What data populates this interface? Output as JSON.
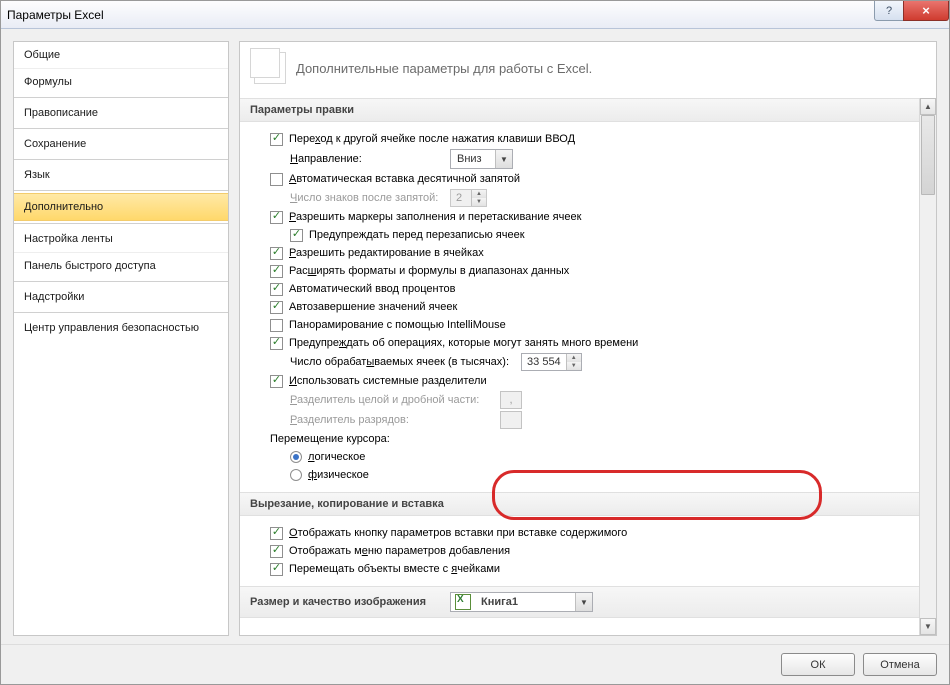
{
  "titlebar": {
    "title": "Параметры Excel"
  },
  "sidebar": {
    "items": [
      {
        "label": "Общие"
      },
      {
        "label": "Формулы"
      },
      {
        "label": "Правописание"
      },
      {
        "label": "Сохранение"
      },
      {
        "label": "Язык"
      },
      {
        "label": "Дополнительно"
      },
      {
        "label": "Настройка ленты"
      },
      {
        "label": "Панель быстрого доступа"
      },
      {
        "label": "Надстройки"
      },
      {
        "label": "Центр управления безопасностью"
      }
    ],
    "selected_index": 5
  },
  "header": {
    "text": "Дополнительные параметры для работы с Excel."
  },
  "sections": {
    "editing": {
      "title": "Параметры правки"
    },
    "cutcopy": {
      "title": "Вырезание, копирование и вставка"
    },
    "imagequality": {
      "title": "Размер и качество изображения"
    }
  },
  "editing": {
    "move_after_enter": "Переход к другой ячейке после нажатия клавиши ВВОД",
    "direction_label": "Направление:",
    "direction_value": "Вниз",
    "auto_decimal": "Автоматическая вставка десятичной запятой",
    "decimal_places_label": "Число знаков после запятой:",
    "decimal_places_value": "2",
    "fill_handle": "Разрешить маркеры заполнения и перетаскивание ячеек",
    "warn_overwrite": "Предупреждать перед перезаписью ячеек",
    "edit_in_cell": "Разрешить редактирование в ячейках",
    "extend_formats": "Расширять форматы и формулы в диапазонах данных",
    "auto_percent": "Автоматический ввод процентов",
    "autocomplete": "Автозавершение значений ячеек",
    "intellimouse": "Панорамирование с помощью IntelliMouse",
    "warn_long_ops": "Предупреждать об операциях, которые могут занять много времени",
    "cells_thousands_label": "Число обрабатываемых ячеек (в тысячах):",
    "cells_thousands_value": "33 554",
    "use_system_sep": "Использовать системные разделители",
    "decimal_sep_label": "Разделитель целой и дробной части:",
    "decimal_sep_value": ",",
    "thousand_sep_label": "Разделитель разрядов:",
    "thousand_sep_value": "",
    "cursor_move_label": "Перемещение курсора:",
    "cursor_logical": "логическое",
    "cursor_physical": "физическое"
  },
  "cutcopy": {
    "show_paste_button": "Отображать кнопку параметров вставки при вставке содержимого",
    "show_insert_menu": "Отображать меню параметров добавления",
    "move_objects": "Перемещать объекты вместе с ячейками"
  },
  "imagequality": {
    "workbook": "Книга1"
  },
  "footer": {
    "ok": "ОК",
    "cancel": "Отмена"
  }
}
